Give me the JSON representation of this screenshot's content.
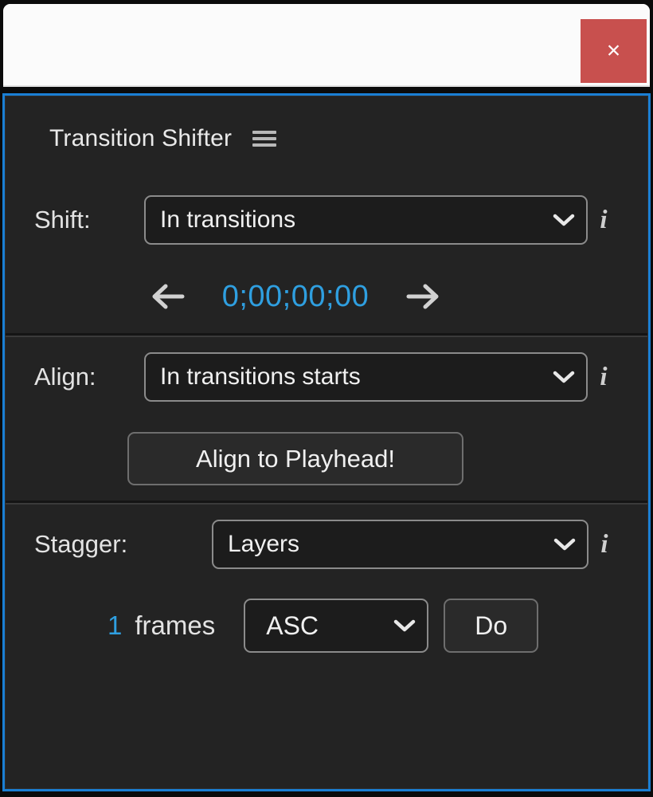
{
  "window": {
    "close_label": "×"
  },
  "panel": {
    "title": "Transition Shifter",
    "menu_icon": "hamburger-menu-icon",
    "accent_border_color": "#1a7fd4",
    "background_color": "#232323"
  },
  "shift": {
    "label": "Shift:",
    "selected": "In transitions",
    "info_glyph": "i",
    "prev_icon": "arrow-left-icon",
    "next_icon": "arrow-right-icon",
    "timecode": "0;00;00;00",
    "timecode_color": "#2f9fe0"
  },
  "align": {
    "label": "Align:",
    "selected": "In transitions starts",
    "info_glyph": "i",
    "action_label": "Align to Playhead!"
  },
  "stagger": {
    "label": "Stagger:",
    "selected": "Layers",
    "info_glyph": "i",
    "frames_value": "1",
    "frames_label": "frames",
    "order_selected": "ASC",
    "do_label": "Do"
  }
}
